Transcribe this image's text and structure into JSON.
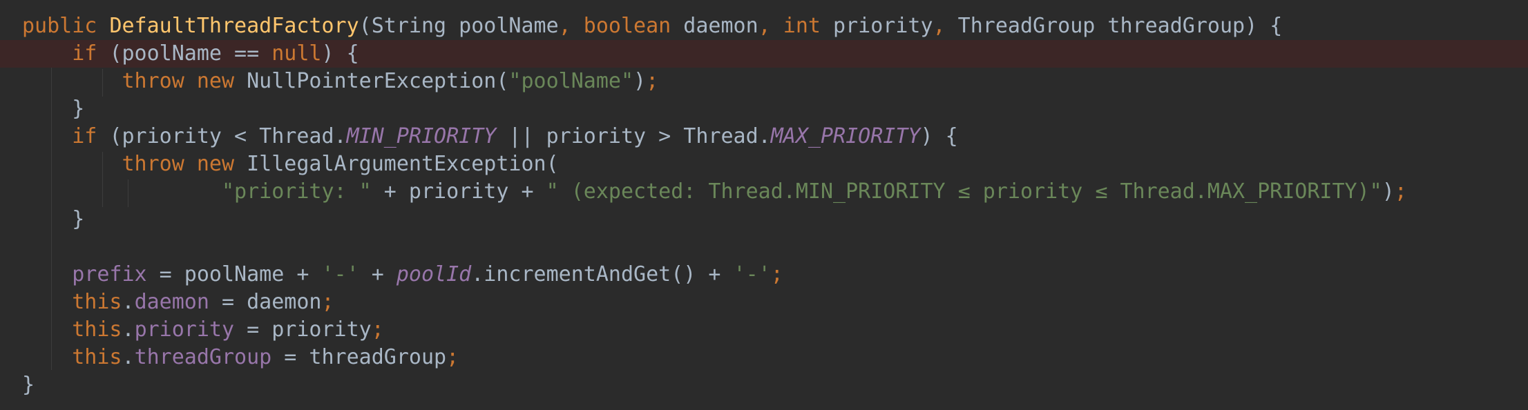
{
  "code": {
    "lines": [
      {
        "tokens": [
          {
            "t": "public ",
            "c": "kw"
          },
          {
            "t": "DefaultThreadFactory",
            "c": "fn"
          },
          {
            "t": "(String poolName",
            "c": "op"
          },
          {
            "t": ", ",
            "c": "kw"
          },
          {
            "t": "boolean ",
            "c": "kw"
          },
          {
            "t": "daemon",
            "c": "op"
          },
          {
            "t": ", ",
            "c": "kw"
          },
          {
            "t": "int ",
            "c": "kw"
          },
          {
            "t": "priority",
            "c": "op"
          },
          {
            "t": ", ",
            "c": "kw"
          },
          {
            "t": "ThreadGroup threadGroup) {",
            "c": "op"
          }
        ]
      },
      {
        "highlight": true,
        "tokens": [
          {
            "t": "    ",
            "c": "op"
          },
          {
            "t": "if ",
            "c": "kw"
          },
          {
            "t": "(poolName == ",
            "c": "op"
          },
          {
            "t": "null",
            "c": "kw"
          },
          {
            "t": ") {",
            "c": "op"
          }
        ]
      },
      {
        "tokens": [
          {
            "t": "        ",
            "c": "op"
          },
          {
            "t": "throw new ",
            "c": "kw"
          },
          {
            "t": "NullPointerException(",
            "c": "op"
          },
          {
            "t": "\"poolName\"",
            "c": "str"
          },
          {
            "t": ")",
            "c": "op"
          },
          {
            "t": ";",
            "c": "kw"
          }
        ]
      },
      {
        "tokens": [
          {
            "t": "    }",
            "c": "op"
          }
        ]
      },
      {
        "tokens": [
          {
            "t": "    ",
            "c": "op"
          },
          {
            "t": "if ",
            "c": "kw"
          },
          {
            "t": "(priority < Thread.",
            "c": "op"
          },
          {
            "t": "MIN_PRIORITY",
            "c": "sf"
          },
          {
            "t": " || priority > Thread.",
            "c": "op"
          },
          {
            "t": "MAX_PRIORITY",
            "c": "sf"
          },
          {
            "t": ") {",
            "c": "op"
          }
        ]
      },
      {
        "tokens": [
          {
            "t": "        ",
            "c": "op"
          },
          {
            "t": "throw new ",
            "c": "kw"
          },
          {
            "t": "IllegalArgumentException(",
            "c": "op"
          }
        ]
      },
      {
        "tokens": [
          {
            "t": "                ",
            "c": "op"
          },
          {
            "t": "\"priority: \"",
            "c": "str"
          },
          {
            "t": " + priority + ",
            "c": "op"
          },
          {
            "t": "\" (expected: Thread.MIN_PRIORITY ≤ priority ≤ Thread.MAX_PRIORITY)\"",
            "c": "str"
          },
          {
            "t": ")",
            "c": "op"
          },
          {
            "t": ";",
            "c": "kw"
          }
        ]
      },
      {
        "tokens": [
          {
            "t": "    }",
            "c": "op"
          }
        ]
      },
      {
        "tokens": []
      },
      {
        "tokens": [
          {
            "t": "    ",
            "c": "op"
          },
          {
            "t": "prefix",
            "c": "fld"
          },
          {
            "t": " = poolName + ",
            "c": "op"
          },
          {
            "t": "'-'",
            "c": "str"
          },
          {
            "t": " + ",
            "c": "op"
          },
          {
            "t": "poolId",
            "c": "it"
          },
          {
            "t": ".incrementAndGet() + ",
            "c": "op"
          },
          {
            "t": "'-'",
            "c": "str"
          },
          {
            "t": ";",
            "c": "kw"
          }
        ]
      },
      {
        "tokens": [
          {
            "t": "    ",
            "c": "op"
          },
          {
            "t": "this",
            "c": "kw"
          },
          {
            "t": ".",
            "c": "op"
          },
          {
            "t": "daemon",
            "c": "fld"
          },
          {
            "t": " = daemon",
            "c": "op"
          },
          {
            "t": ";",
            "c": "kw"
          }
        ]
      },
      {
        "tokens": [
          {
            "t": "    ",
            "c": "op"
          },
          {
            "t": "this",
            "c": "kw"
          },
          {
            "t": ".",
            "c": "op"
          },
          {
            "t": "priority",
            "c": "fld"
          },
          {
            "t": " = priority",
            "c": "op"
          },
          {
            "t": ";",
            "c": "kw"
          }
        ]
      },
      {
        "tokens": [
          {
            "t": "    ",
            "c": "op"
          },
          {
            "t": "this",
            "c": "kw"
          },
          {
            "t": ".",
            "c": "op"
          },
          {
            "t": "threadGroup",
            "c": "fld"
          },
          {
            "t": " = threadGroup",
            "c": "op"
          },
          {
            "t": ";",
            "c": "kw"
          }
        ]
      },
      {
        "tokens": [
          {
            "t": "}",
            "c": "op"
          }
        ]
      }
    ]
  },
  "colors": {
    "background": "#2b2b2b",
    "highlight_line": "#3c2626",
    "keyword": "#cc7832",
    "function": "#ffc66d",
    "string": "#6a8759",
    "field": "#9876aa",
    "text": "#a9b7c6"
  }
}
